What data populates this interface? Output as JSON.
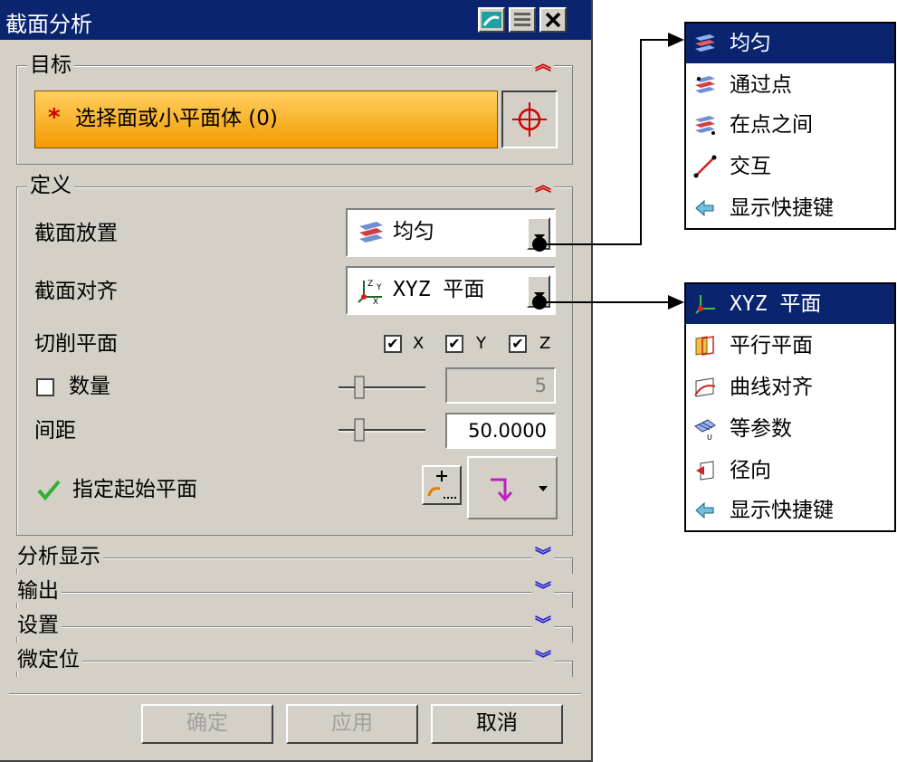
{
  "dialog": {
    "title": "截面分析",
    "target": {
      "title": "目标",
      "select_label": "选择面或小平面体 (0)",
      "required_mark": "*"
    },
    "definition": {
      "title": "定义",
      "placement_label": "截面放置",
      "placement_value": "均匀",
      "alignment_label": "截面对齐",
      "alignment_value": "XYZ 平面",
      "cut_planes_label": "切削平面",
      "axes": [
        "X",
        "Y",
        "Z"
      ],
      "count_label": "数量",
      "count_value": "5",
      "spacing_label": "间距",
      "spacing_value": "50.0000",
      "start_plane_label": "指定起始平面"
    },
    "collapsed_sections": [
      "分析显示",
      "输出",
      "设置",
      "微定位"
    ],
    "buttons": {
      "ok": "确定",
      "apply": "应用",
      "cancel": "取消"
    }
  },
  "placement_menu": [
    "均匀",
    "通过点",
    "在点之间",
    "交互",
    "显示快捷键"
  ],
  "alignment_menu": [
    "XYZ 平面",
    "平行平面",
    "曲线对齐",
    "等参数",
    "径向",
    "显示快捷键"
  ],
  "colors": {
    "title_bar": "#0a2470",
    "dialog_bg": "#d4d0c8",
    "select_highlight": "#f4a000"
  }
}
